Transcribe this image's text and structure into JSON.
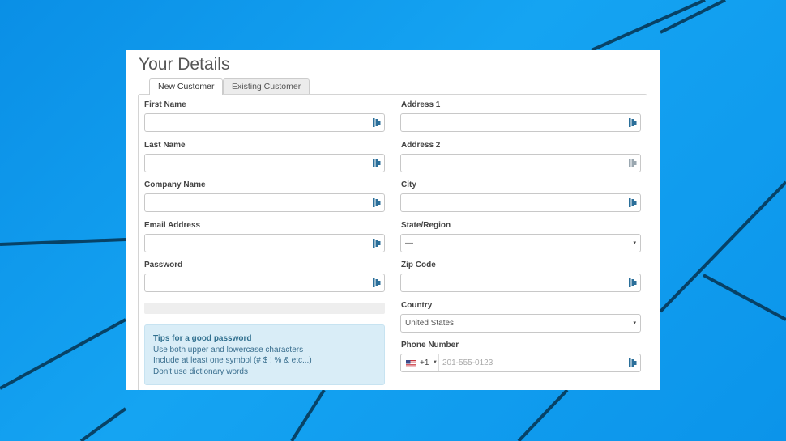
{
  "page": {
    "title": "Your Details",
    "tabs": [
      {
        "label": "New Customer"
      },
      {
        "label": "Existing Customer"
      }
    ]
  },
  "form": {
    "first_name": {
      "label": "First Name",
      "value": ""
    },
    "last_name": {
      "label": "Last Name",
      "value": ""
    },
    "company_name": {
      "label": "Company Name",
      "value": ""
    },
    "email": {
      "label": "Email Address",
      "value": ""
    },
    "password": {
      "label": "Password",
      "value": ""
    },
    "address1": {
      "label": "Address 1",
      "value": ""
    },
    "address2": {
      "label": "Address 2",
      "value": ""
    },
    "city": {
      "label": "City",
      "value": ""
    },
    "state": {
      "label": "State/Region",
      "value": "—"
    },
    "zip": {
      "label": "Zip Code",
      "value": ""
    },
    "country": {
      "label": "Country",
      "value": "United States"
    },
    "phone": {
      "label": "Phone Number",
      "code": "+1",
      "placeholder": "201-555-0123"
    }
  },
  "password_tips": {
    "title": "Tips for a good password",
    "lines": [
      "Use both upper and lowercase characters",
      "Include at least one symbol (# $ ! % & etc...)",
      "Don't use dictionary words"
    ]
  },
  "colors": {
    "desktop_blue": "#0a8fe6",
    "tips_background": "#d9edf7",
    "tips_text": "#31708f",
    "password_manager_icon": "#2b6f9a"
  },
  "icons": {
    "field_icon": "password-manager-icon",
    "select_caret": "▾",
    "phone_flag": "us-flag-icon"
  }
}
